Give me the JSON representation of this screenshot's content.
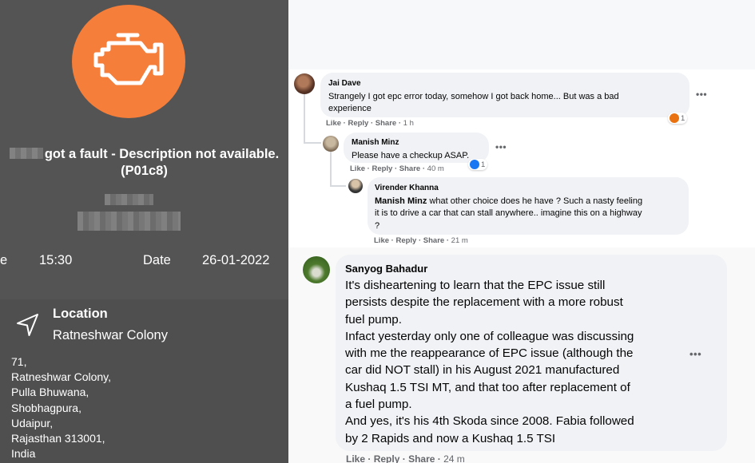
{
  "app": {
    "fault_text": "got a fault - Description not available.",
    "fault_code": "(P01c8)",
    "time_label_partial": "e",
    "time_value": "15:30",
    "date_label": "Date",
    "date_value": "26-01-2022",
    "location_title": "Location",
    "location_name": "Ratneshwar Colony",
    "address_lines": [
      "71,",
      "Ratneshwar Colony,",
      "Pulla Bhuwana,",
      "Shobhagpura,",
      "Udaipur,",
      "Rajasthan 313001,",
      "India"
    ],
    "accent_color": "#f47e3a",
    "icons": [
      "engine-check-icon",
      "navigation-arrow-icon"
    ]
  },
  "comments": {
    "c1": {
      "author": "Jai Dave",
      "text_line1": "Strangely I got epc error today, somehow I got back home... But was a bad",
      "text_line2": "experience",
      "like": "Like",
      "reply": "Reply",
      "share": "Share",
      "time": "1 h",
      "reaction_count": "1"
    },
    "c2": {
      "author": "Manish Minz",
      "text": "Please have a checkup ASAP.",
      "like": "Like",
      "reply": "Reply",
      "share": "Share",
      "time": "40 m",
      "reaction_count": "1"
    },
    "c3": {
      "author": "Virender Khanna",
      "mention": "Manish Minz",
      "text_line1": " what other choice does he have ? Such a nasty feeling",
      "text_line2": "it is to drive a car that can stall anywhere.. imagine this on a highway",
      "text_line3": "?",
      "like": "Like",
      "reply": "Reply",
      "share": "Share",
      "time": "21 m"
    },
    "c4": {
      "author": "Sanyog Bahadur",
      "lines": [
        "It's disheartening to learn that the EPC issue still",
        "persists despite the replacement with a more robust",
        "fuel pump.",
        "Infact yesterday only one of colleague was discussing",
        "with me the reappearance of EPC issue (although the",
        "car did NOT stall) in his August 2021 manufactured",
        "Kushaq 1.5 TSI MT, and that too after replacement of",
        "a fuel pump.",
        "And yes, it's his 4th Skoda since 2008. Fabia followed",
        "by 2 Rapids and now a Kushaq 1.5 TSI"
      ],
      "like": "Like",
      "reply": "Reply",
      "share": "Share",
      "time": "24 m"
    },
    "more": "•••",
    "sep": "·"
  }
}
